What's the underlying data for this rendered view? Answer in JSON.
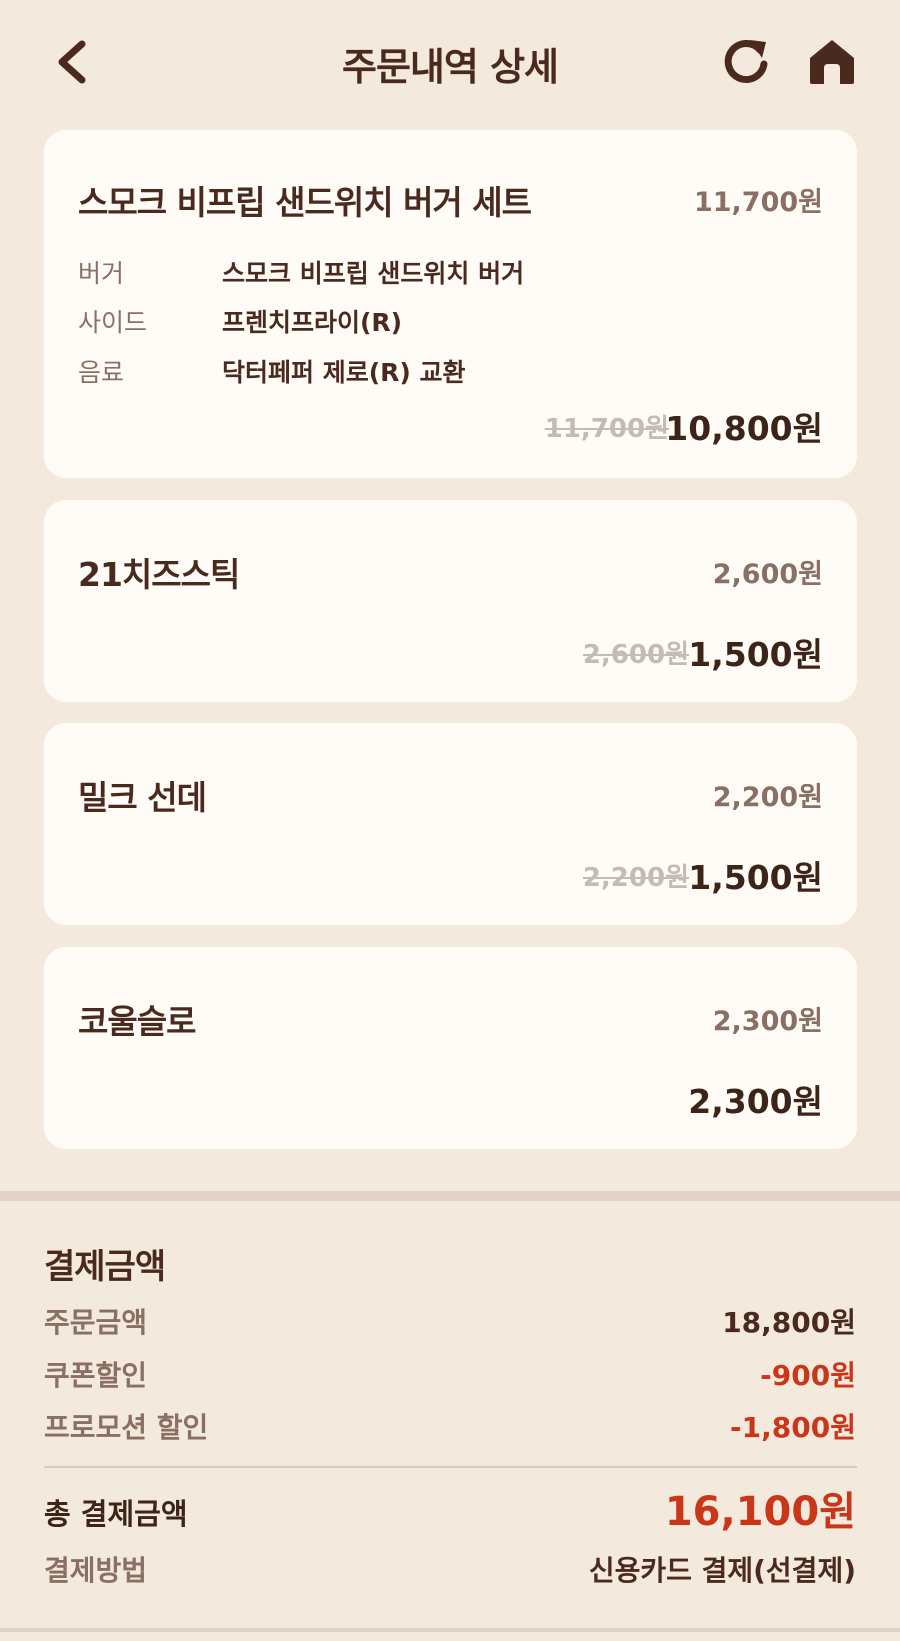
{
  "header": {
    "title": "주문내역 상세",
    "back_icon": "chevron-left-icon",
    "refresh_icon": "refresh-icon",
    "home_icon": "home-icon"
  },
  "items": [
    {
      "name": "스모크 비프립 샌드위치 버거 세트",
      "unit_price": "11,700원",
      "options": [
        {
          "label": "버거",
          "value": "스모크 비프립 샌드위치 버거"
        },
        {
          "label": "사이드",
          "value": "프렌치프라이(R)"
        },
        {
          "label": "음료",
          "value": "닥터페퍼 제로(R) 교환"
        }
      ],
      "original_price": "11,700원",
      "final_price": "10,800원"
    },
    {
      "name": "21치즈스틱",
      "unit_price": "2,600원",
      "original_price": "2,600원",
      "final_price": "1,500원"
    },
    {
      "name": "밀크 선데",
      "unit_price": "2,200원",
      "original_price": "2,200원",
      "final_price": "1,500원"
    },
    {
      "name": "코울슬로",
      "unit_price": "2,300원",
      "final_price": "2,300원"
    }
  ],
  "payment": {
    "title": "결제금액",
    "order_amount_label": "주문금액",
    "order_amount": "18,800원",
    "coupon_label": "쿠폰할인",
    "coupon_amount": "-900원",
    "promo_label": "프로모션 할인",
    "promo_amount": "-1,800원",
    "total_label": "총 결제금액",
    "total_amount": "16,100원",
    "method_label": "결제방법",
    "method_value": "신용카드 결제(선결제)"
  },
  "colors": {
    "background": "#f3e9dd",
    "card": "#fffcf7",
    "accent_red": "#c9361a",
    "text_dark": "#4a2a1f"
  }
}
